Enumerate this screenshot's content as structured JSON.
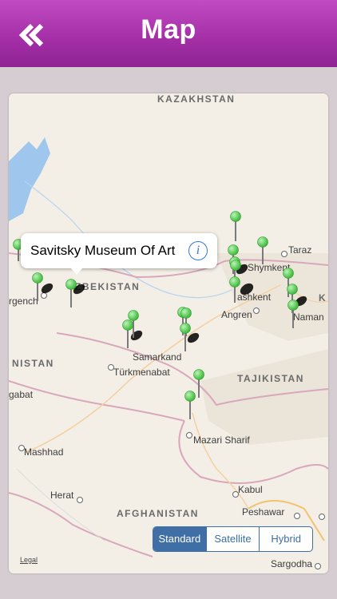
{
  "header": {
    "title": "Map",
    "back_label": "back"
  },
  "callout": {
    "title": "Savitsky Museum Of Art"
  },
  "map": {
    "countries": [
      "KAZAKHSTAN",
      "ZBEKISTAN",
      "NISTAN",
      "TAJIKISTAN",
      "AFGHANISTAN",
      "K"
    ],
    "cities": [
      "Taraz",
      "Shymkent",
      "ashkent",
      "Angren",
      "Naman",
      "Samarkand",
      "Türkmenabat",
      "gabat",
      "Mazari Sharif",
      "Mashhad",
      "Herat",
      "Kabul",
      "Peshawar",
      "Sargodha",
      "rgench"
    ]
  },
  "map_type": {
    "options": [
      "Standard",
      "Satellite",
      "Hybrid"
    ],
    "selected": "Standard"
  },
  "legal": "Legal",
  "colors": {
    "header": "#a32ea6",
    "pin_green": "#5ed35c",
    "segment": "#3f6fa4",
    "water": "#9fc6ec"
  }
}
